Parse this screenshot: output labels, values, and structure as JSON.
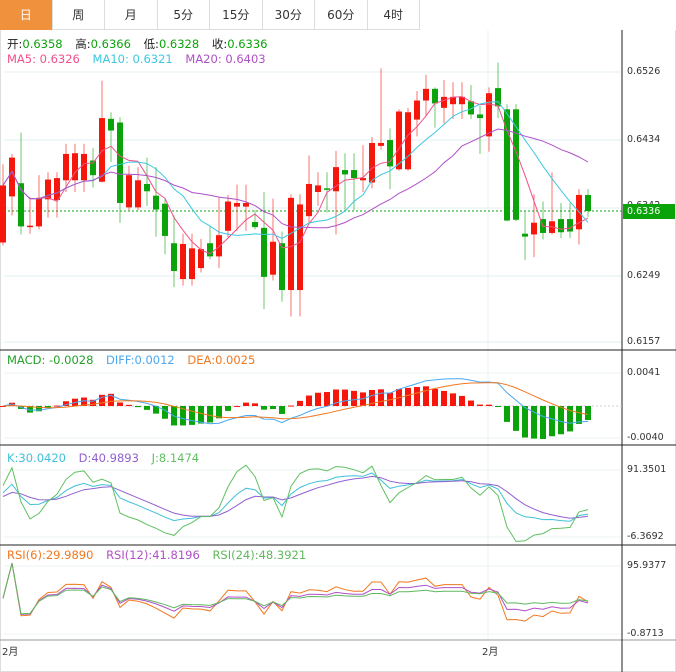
{
  "tabs": [
    "日",
    "周",
    "月",
    "5分",
    "15分",
    "30分",
    "60分",
    "4时"
  ],
  "active_tab": 0,
  "ohlc": {
    "open_label": "开:",
    "open": "0.6358",
    "high_label": "高:",
    "high": "0.6366",
    "low_label": "低:",
    "low": "0.6328",
    "close_label": "收:",
    "close": "0.6336"
  },
  "ma": {
    "ma5": "MA5: 0.6326",
    "ma10": "MA10: 0.6321",
    "ma20": "MA20: 0.6403"
  },
  "macd": {
    "macd": "MACD: -0.0028",
    "diff": "DIFF:0.0012",
    "dea": "DEA:0.0025",
    "axis": [
      "0.0041",
      "-0.0040"
    ]
  },
  "kdj": {
    "k": "K:30.0420",
    "d": "D:40.9893",
    "j": "J:8.1474",
    "axis": [
      "91.3501",
      "-6.3692"
    ]
  },
  "rsi": {
    "r6": "RSI(6):29.9890",
    "r12": "RSI(12):41.8196",
    "r24": "RSI(24):48.3921",
    "axis": [
      "95.9377",
      "-0.8713"
    ]
  },
  "price_axis": [
    "0.6526",
    "0.6434",
    "0.6342",
    "0.6249",
    "0.6157"
  ],
  "current_price": "0.6336",
  "x_labels": [
    "2月",
    "2月"
  ],
  "colors": {
    "up": "#f5170c",
    "down": "#0aa40a",
    "ma5": "#f0508a",
    "ma10": "#3cc8e0",
    "ma20": "#b050c8",
    "diff": "#4aa8f0",
    "dea": "#f07820",
    "k": "#40c0d8",
    "d": "#9060d0",
    "j": "#60c060",
    "r6": "#f07820",
    "r12": "#b050c8",
    "r24": "#60b860",
    "tab_active": "#f0913e"
  },
  "chart_data": {
    "type": "candlestick",
    "ylim": [
      0.6157,
      0.6526
    ],
    "candles": [
      [
        0.6293,
        0.64,
        0.6289,
        0.6371
      ],
      [
        0.6356,
        0.6414,
        0.633,
        0.6409
      ],
      [
        0.6374,
        0.6443,
        0.6304,
        0.6315
      ],
      [
        0.6314,
        0.6355,
        0.6305,
        0.6316
      ],
      [
        0.6315,
        0.6385,
        0.6311,
        0.6354
      ],
      [
        0.6352,
        0.6389,
        0.6327,
        0.6379
      ],
      [
        0.6351,
        0.6389,
        0.6327,
        0.6381
      ],
      [
        0.6378,
        0.6428,
        0.6362,
        0.6414
      ],
      [
        0.6378,
        0.6428,
        0.6362,
        0.6415
      ],
      [
        0.6378,
        0.6428,
        0.6362,
        0.6414
      ],
      [
        0.6405,
        0.6422,
        0.6368,
        0.6385
      ],
      [
        0.6376,
        0.6514,
        0.6375,
        0.6463
      ],
      [
        0.6462,
        0.6471,
        0.6403,
        0.6446
      ],
      [
        0.6457,
        0.6464,
        0.632,
        0.6347
      ],
      [
        0.6341,
        0.6398,
        0.6337,
        0.6385
      ],
      [
        0.6341,
        0.6396,
        0.6337,
        0.6378
      ],
      [
        0.6373,
        0.6409,
        0.6343,
        0.6363
      ],
      [
        0.6357,
        0.6396,
        0.6301,
        0.6338
      ],
      [
        0.6346,
        0.6352,
        0.6277,
        0.6302
      ],
      [
        0.6292,
        0.633,
        0.6232,
        0.6254
      ],
      [
        0.6243,
        0.6305,
        0.6234,
        0.6291
      ],
      [
        0.6243,
        0.6305,
        0.6234,
        0.6285
      ],
      [
        0.6258,
        0.6298,
        0.6252,
        0.6284
      ],
      [
        0.6292,
        0.6316,
        0.627,
        0.6274
      ],
      [
        0.6274,
        0.6355,
        0.6258,
        0.6303
      ],
      [
        0.6309,
        0.6358,
        0.63,
        0.6349
      ],
      [
        0.6342,
        0.6372,
        0.6309,
        0.6347
      ],
      [
        0.6342,
        0.6372,
        0.6309,
        0.6347
      ],
      [
        0.6321,
        0.6337,
        0.6311,
        0.6314
      ],
      [
        0.6313,
        0.6362,
        0.6202,
        0.6246
      ],
      [
        0.6249,
        0.6353,
        0.6241,
        0.6294
      ],
      [
        0.6292,
        0.6308,
        0.6212,
        0.6228
      ],
      [
        0.6228,
        0.6359,
        0.6192,
        0.6354
      ],
      [
        0.6228,
        0.6359,
        0.6192,
        0.6345
      ],
      [
        0.6329,
        0.6412,
        0.632,
        0.6373
      ],
      [
        0.6362,
        0.6389,
        0.6343,
        0.6371
      ],
      [
        0.6367,
        0.6389,
        0.6334,
        0.6365
      ],
      [
        0.6363,
        0.6418,
        0.6304,
        0.6396
      ],
      [
        0.6392,
        0.6415,
        0.6337,
        0.6386
      ],
      [
        0.6392,
        0.6415,
        0.6337,
        0.6381
      ],
      [
        0.6378,
        0.6426,
        0.6362,
        0.6381
      ],
      [
        0.6375,
        0.6437,
        0.6367,
        0.6429
      ],
      [
        0.6425,
        0.6531,
        0.642,
        0.6429
      ],
      [
        0.6433,
        0.6449,
        0.6366,
        0.6397
      ],
      [
        0.6393,
        0.6475,
        0.6391,
        0.6472
      ],
      [
        0.6393,
        0.6477,
        0.6391,
        0.6471
      ],
      [
        0.6461,
        0.65,
        0.6438,
        0.6487
      ],
      [
        0.6487,
        0.6522,
        0.6466,
        0.6503
      ],
      [
        0.6503,
        0.6505,
        0.645,
        0.6483
      ],
      [
        0.6477,
        0.6515,
        0.6456,
        0.6492
      ],
      [
        0.6482,
        0.6512,
        0.6462,
        0.6492
      ],
      [
        0.6482,
        0.6512,
        0.6462,
        0.6492
      ],
      [
        0.6486,
        0.6508,
        0.6462,
        0.6468
      ],
      [
        0.6468,
        0.648,
        0.6414,
        0.6463
      ],
      [
        0.6438,
        0.6505,
        0.6417,
        0.6497
      ],
      [
        0.6504,
        0.6539,
        0.6463,
        0.6479
      ],
      [
        0.6475,
        0.6482,
        0.6322,
        0.6323
      ],
      [
        0.6475,
        0.6482,
        0.6322,
        0.6324
      ],
      [
        0.6305,
        0.6335,
        0.6269,
        0.6301
      ],
      [
        0.6304,
        0.6359,
        0.6273,
        0.632
      ],
      [
        0.6325,
        0.6349,
        0.6297,
        0.6306
      ],
      [
        0.6306,
        0.6389,
        0.6304,
        0.6322
      ],
      [
        0.6325,
        0.6347,
        0.6299,
        0.6307
      ],
      [
        0.6325,
        0.6347,
        0.6299,
        0.6308
      ],
      [
        0.6311,
        0.6366,
        0.629,
        0.6358
      ],
      [
        0.6358,
        0.6366,
        0.6328,
        0.6336
      ]
    ]
  }
}
